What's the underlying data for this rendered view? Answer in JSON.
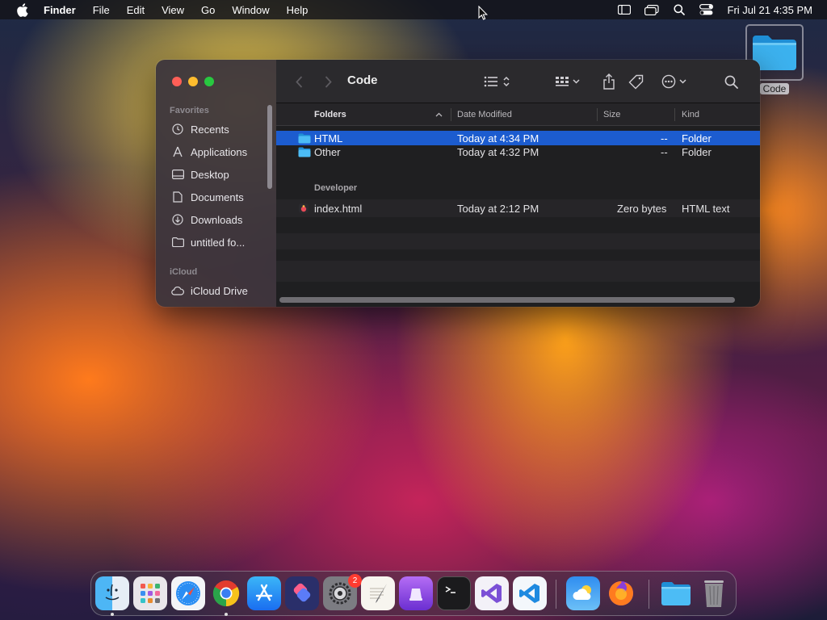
{
  "menubar": {
    "app_name": "Finder",
    "items": [
      "File",
      "Edit",
      "View",
      "Go",
      "Window",
      "Help"
    ],
    "clock": "Fri Jul 21  4:35 PM"
  },
  "desktop": {
    "folder_label": "Code"
  },
  "finder": {
    "title": "Code",
    "sidebar": {
      "favorites_heading": "Favorites",
      "favorites": [
        "Recents",
        "Applications",
        "Desktop",
        "Documents",
        "Downloads",
        "untitled fo..."
      ],
      "icloud_heading": "iCloud",
      "icloud": [
        "iCloud Drive"
      ]
    },
    "columns": {
      "name": "Folders",
      "date": "Date Modified",
      "size": "Size",
      "kind": "Kind"
    },
    "groups": [
      {
        "heading": "",
        "rows": [
          {
            "name": "HTML",
            "date": "Today at 4:34 PM",
            "size": "--",
            "kind": "Folder",
            "selected": true
          },
          {
            "name": "Other",
            "date": "Today at 4:32 PM",
            "size": "--",
            "kind": "Folder",
            "selected": false
          }
        ]
      },
      {
        "heading": "Developer",
        "rows": [
          {
            "name": "index.html",
            "date": "Today at 2:12 PM",
            "size": "Zero bytes",
            "kind": "HTML text",
            "selected": false
          }
        ]
      }
    ],
    "accent_color": "#1c5ccf"
  },
  "dock": {
    "apps": [
      "finder-icon",
      "launchpad-icon",
      "safari-icon",
      "chrome-icon",
      "app-store-icon",
      "shortcuts-icon",
      "system-settings-icon",
      "textedit-icon",
      "podcast-app-icon",
      "terminal-icon",
      "visual-studio-icon",
      "vscode-icon",
      "weather-icon",
      "firefox-icon",
      "files-folder-icon",
      "trash-icon"
    ],
    "settings_badge": "2"
  }
}
